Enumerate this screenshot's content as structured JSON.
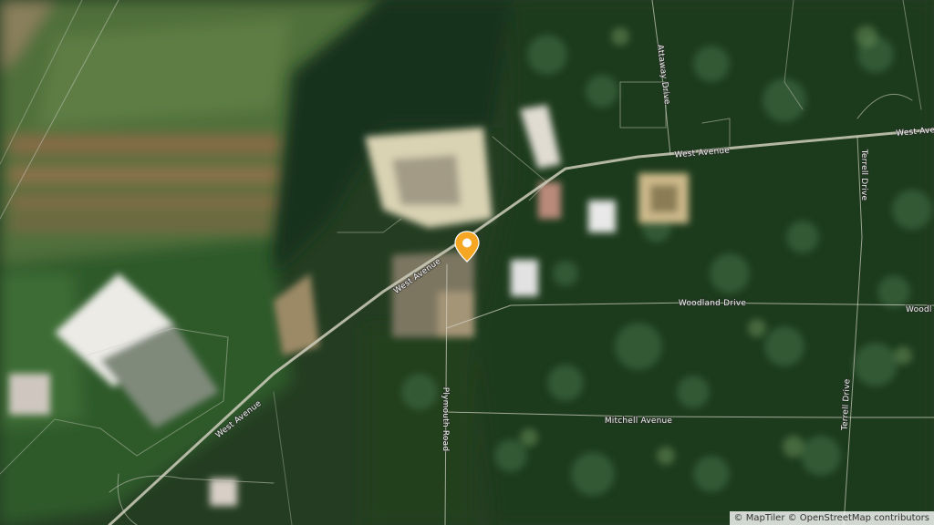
{
  "map": {
    "style": "satellite",
    "colors": {
      "vegetation_dark": "#1e3a1c",
      "vegetation_mid": "#3f6a35",
      "field_light": "#5c7a3e",
      "road_line": "#c9c9b8",
      "pin": "#f5a623",
      "pin_center": "#ffffff"
    },
    "roads": [
      {
        "id": "west-avenue-1",
        "label": "West Avenue"
      },
      {
        "id": "west-avenue-2",
        "label": "West Avenue"
      },
      {
        "id": "west-avenue-3",
        "label": "West Avenue"
      },
      {
        "id": "west-avenue-4",
        "label": "West Ave"
      },
      {
        "id": "attaway-drive",
        "label": "Attaway Drive"
      },
      {
        "id": "terrell-drive-1",
        "label": "Terrell Drive"
      },
      {
        "id": "terrell-drive-2",
        "label": "Terrell Drive"
      },
      {
        "id": "woodland-drive-1",
        "label": "Woodland Drive"
      },
      {
        "id": "woodland-drive-2",
        "label": "Woodl"
      },
      {
        "id": "plymouth-road",
        "label": "Plymouth Road"
      },
      {
        "id": "mitchell-avenue",
        "label": "Mitchell Avenue"
      }
    ],
    "marker": {
      "icon": "map-pin-icon"
    }
  },
  "attribution": {
    "maptiler": "© MapTiler",
    "osm": "© OpenStreetMap contributors"
  }
}
